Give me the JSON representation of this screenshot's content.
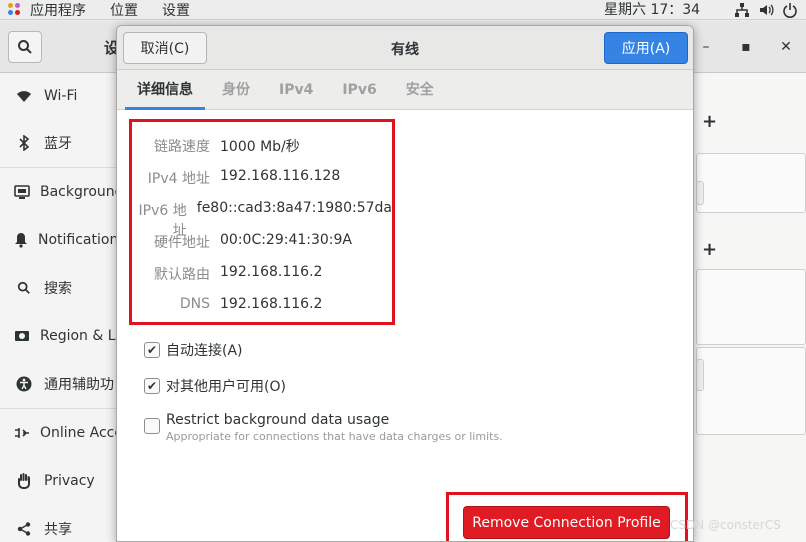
{
  "topbar": {
    "apps": "应用程序",
    "places": "位置",
    "settings": "设置",
    "clock": "星期六 17：34",
    "icons": [
      "network-icon",
      "volume-icon",
      "power-icon"
    ]
  },
  "settings_window": {
    "title_fragment": "设",
    "win_controls": {
      "minimize": "–",
      "maximize": "▪",
      "close": "✕"
    },
    "sidebar": [
      {
        "label": "Wi-Fi",
        "icon": "wifi-icon"
      },
      {
        "label": "蓝牙",
        "icon": "bluetooth-icon"
      },
      {
        "label": "Background",
        "icon": "background-icon"
      },
      {
        "label": "Notifications",
        "icon": "bell-icon"
      },
      {
        "label": "搜索",
        "icon": "search-icon"
      },
      {
        "label": "Region & La",
        "icon": "region-icon"
      },
      {
        "label": "通用辅助功",
        "icon": "accessibility-icon"
      },
      {
        "label": "Online Acco",
        "icon": "online-accounts-icon"
      },
      {
        "label": "Privacy",
        "icon": "hand-icon"
      },
      {
        "label": "共享",
        "icon": "share-icon"
      }
    ],
    "plus": "+"
  },
  "dialog": {
    "cancel": "取消(C)",
    "title": "有线",
    "apply": "应用(A)",
    "tabs": [
      "详细信息",
      "身份",
      "IPv4",
      "IPv6",
      "安全"
    ],
    "details": [
      {
        "label": "链路速度",
        "value": "1000 Mb/秒"
      },
      {
        "label": "IPv4 地址",
        "value": "192.168.116.128"
      },
      {
        "label": "IPv6 地址",
        "value": "fe80::cad3:8a47:1980:57da"
      },
      {
        "label": "硬件地址",
        "value": "00:0C:29:41:30:9A"
      },
      {
        "label": "默认路由",
        "value": "192.168.116.2"
      },
      {
        "label": "DNS",
        "value": "192.168.116.2"
      }
    ],
    "auto_connect": {
      "label": "自动连接(A)",
      "checked": true
    },
    "all_users": {
      "label": "对其他用户可用(O)",
      "checked": true
    },
    "restrict": {
      "label": "Restrict background data usage",
      "hint": "Appropriate for connections that have data charges or limits.",
      "checked": false
    },
    "remove": "Remove Connection Profile"
  },
  "watermark": "CSDN @consterCS",
  "colors": {
    "accent": "#3584e4",
    "destructive": "#e01b24",
    "highlight": "#e0121e"
  }
}
